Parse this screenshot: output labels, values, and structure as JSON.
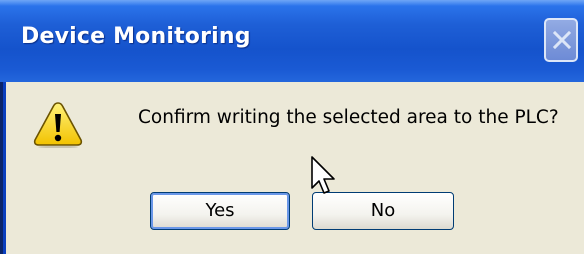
{
  "dialog": {
    "title": "Device Monitoring",
    "message": "Confirm writing the selected area to the PLC?",
    "buttons": {
      "yes_label": "Yes",
      "no_label": "No"
    },
    "icon": "warning-icon"
  },
  "colors": {
    "titlebar": "#1553cc",
    "client_bg": "#ece9d8",
    "button_border": "#003c74"
  }
}
